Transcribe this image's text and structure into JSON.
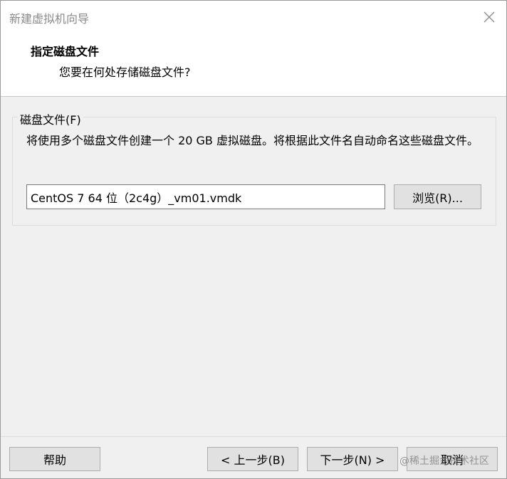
{
  "window": {
    "title": "新建虚拟机向导"
  },
  "header": {
    "title": "指定磁盘文件",
    "subtitle": "您要在何处存储磁盘文件?"
  },
  "disk_file": {
    "group_label": "磁盘文件(F)",
    "description": "将使用多个磁盘文件创建一个 20 GB 虚拟磁盘。将根据此文件名自动命名这些磁盘文件。",
    "path_value": "CentOS 7 64 位（2c4g）_vm01.vmdk",
    "browse_label": "浏览(R)..."
  },
  "footer": {
    "help_label": "帮助",
    "back_label": "< 上一步(B)",
    "next_label": "下一步(N) >",
    "cancel_label": "取消"
  },
  "watermark": "@稀土掘金技术社区",
  "icons": {
    "close": "close-icon"
  }
}
